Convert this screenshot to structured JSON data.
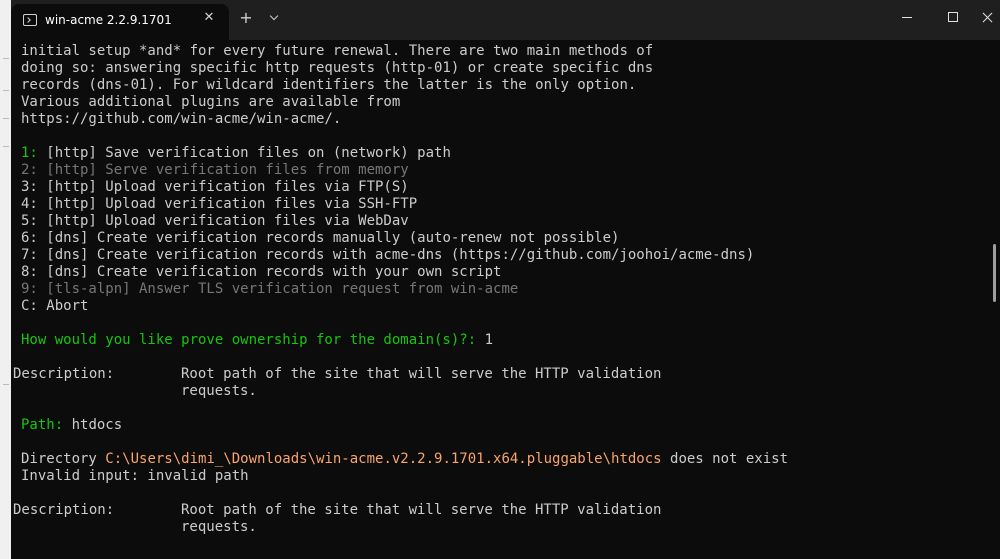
{
  "window": {
    "tab_title": "win-acme 2.2.9.1701",
    "close_tab": "✕",
    "new_tab": "+"
  },
  "terminal": {
    "intro": [
      "initial setup *and* for every future renewal. There are two main methods of",
      "doing so: answering specific http requests (http-01) or create specific dns",
      "records (dns-01). For wildcard identifiers the latter is the only option.",
      "Various additional plugins are available from",
      "https://github.com/win-acme/win-acme/."
    ],
    "options": [
      {
        "key": "1:",
        "text": " [http] Save verification files on (network) path"
      },
      {
        "key": "2:",
        "text": " [http] Serve verification files from memory"
      },
      {
        "key": "3:",
        "text": " [http] Upload verification files via FTP(S)"
      },
      {
        "key": "4:",
        "text": " [http] Upload verification files via SSH-FTP"
      },
      {
        "key": "5:",
        "text": " [http] Upload verification files via WebDav"
      },
      {
        "key": "6:",
        "text": " [dns] Create verification records manually (auto-renew not possible)"
      },
      {
        "key": "7:",
        "text": " [dns] Create verification records with acme-dns (https://github.com/joohoi/acme-dns)"
      },
      {
        "key": "8:",
        "text": " [dns] Create verification records with your own script"
      },
      {
        "key": "9:",
        "text": " [tls-alpn] Answer TLS verification request from win-acme"
      },
      {
        "key": "C:",
        "text": " Abort"
      }
    ],
    "prompt": "How would you like prove ownership for the domain(s)?:",
    "prompt_answer": " 1",
    "description_label": "Description:",
    "description_line1": "Root path of the site that will serve the HTTP validation",
    "description_line2": "requests.",
    "path_label": "Path:",
    "path_value": " htdocs",
    "dir_prefix": "Directory ",
    "dir_path": "C:\\Users\\dimi_\\Downloads\\win-acme.v2.2.9.1701.x64.pluggable\\htdocs",
    "dir_suffix": " does not exist",
    "invalid": "Invalid input: invalid path"
  },
  "colors": {
    "background": "#0c0c0c",
    "text": "#cccccc",
    "green": "#16c60c",
    "disabled": "#767676",
    "path": "#f9a56b"
  }
}
